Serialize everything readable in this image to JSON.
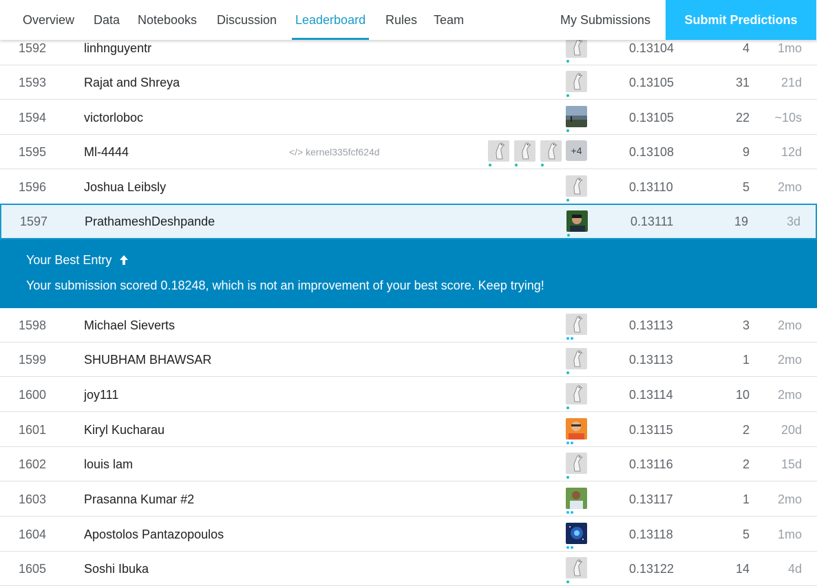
{
  "nav": {
    "tabs": [
      {
        "label": "Overview"
      },
      {
        "label": "Data"
      },
      {
        "label": "Notebooks"
      },
      {
        "label": "Discussion"
      },
      {
        "label": "Leaderboard",
        "active": true
      },
      {
        "label": "Rules"
      },
      {
        "label": "Team"
      }
    ],
    "my_submissions": "My Submissions",
    "submit_button": "Submit Predictions",
    "accent_color": "#1a9ac9",
    "button_color": "#20beff"
  },
  "banner": {
    "title": "Your Best Entry",
    "title_icon": "arrow-up-icon",
    "message": "Your submission scored 0.18248, which is not an improvement of your best score. Keep trying!",
    "color": "#0086bf"
  },
  "rows": [
    {
      "rank": "1592",
      "name": "linhnguyentr",
      "score": "0.13104",
      "entries": "4",
      "last": "1mo",
      "avatar": "goose-avatar",
      "dot_color": "#1dbfaf",
      "dots": 1
    },
    {
      "rank": "1593",
      "name": "Rajat and Shreya",
      "score": "0.13105",
      "entries": "31",
      "last": "21d",
      "avatar": "goose-avatar",
      "dot_color": "#1dbfaf",
      "dots": 1
    },
    {
      "rank": "1594",
      "name": "victorloboc",
      "score": "0.13105",
      "entries": "22",
      "last": "~10s",
      "avatar": "photo-avatar-landscape",
      "dot_color": "#1dbfaf",
      "dots": 1
    },
    {
      "rank": "1595",
      "name": "Ml-4444",
      "kernel": "</> kernel335fcf624d",
      "score": "0.13108",
      "entries": "9",
      "last": "12d",
      "avatar": "goose-avatar",
      "team_extra": "+4",
      "dot_color": "#1dbfaf",
      "dots": 1
    },
    {
      "rank": "1596",
      "name": "Joshua Leibsly",
      "score": "0.13110",
      "entries": "5",
      "last": "2mo",
      "avatar": "goose-avatar",
      "dot_color": "#1dbfaf",
      "dots": 1
    },
    {
      "rank": "1597",
      "name": "PrathameshDeshpande",
      "score": "0.13111",
      "entries": "19",
      "last": "3d",
      "avatar": "photo-avatar-person",
      "dot_color": "#1dbfaf",
      "dots": 1,
      "highlight": true
    },
    {
      "rank": "1598",
      "name": "Michael Sieverts",
      "score": "0.13113",
      "entries": "3",
      "last": "2mo",
      "avatar": "goose-avatar",
      "dot_color": "#20beff",
      "dots": 2
    },
    {
      "rank": "1599",
      "name": "SHUBHAM BHAWSAR",
      "score": "0.13113",
      "entries": "1",
      "last": "2mo",
      "avatar": "goose-avatar",
      "dot_color": "#1dbfaf",
      "dots": 1
    },
    {
      "rank": "1600",
      "name": "joy111",
      "score": "0.13114",
      "entries": "10",
      "last": "2mo",
      "avatar": "goose-avatar",
      "dot_color": "#1dbfaf",
      "dots": 1
    },
    {
      "rank": "1601",
      "name": "Kiryl Kucharau",
      "score": "0.13115",
      "entries": "2",
      "last": "20d",
      "avatar": "photo-avatar-orange",
      "dot_color": "#20beff",
      "dots": 2
    },
    {
      "rank": "1602",
      "name": "louis lam",
      "score": "0.13116",
      "entries": "2",
      "last": "15d",
      "avatar": "goose-avatar",
      "dot_color": "#1dbfaf",
      "dots": 1
    },
    {
      "rank": "1603",
      "name": "Prasanna Kumar #2",
      "score": "0.13117",
      "entries": "1",
      "last": "2mo",
      "avatar": "photo-avatar-person-outdoor",
      "dot_color": "#20beff",
      "dots": 2
    },
    {
      "rank": "1604",
      "name": "Apostolos Pantazopoulos",
      "score": "0.13118",
      "entries": "5",
      "last": "1mo",
      "avatar": "photo-avatar-galaxy",
      "dot_color": "#20beff",
      "dots": 2
    },
    {
      "rank": "1605",
      "name": "Soshi Ibuka",
      "score": "0.13122",
      "entries": "14",
      "last": "4d",
      "avatar": "goose-avatar",
      "dot_color": "#1dbfaf",
      "dots": 1
    }
  ]
}
